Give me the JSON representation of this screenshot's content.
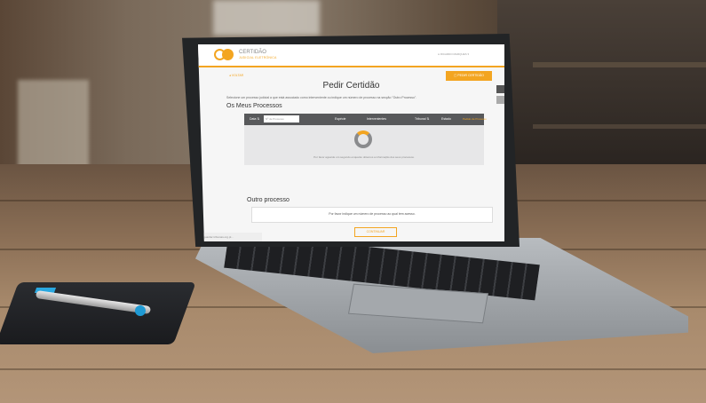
{
  "screen": {
    "brand": {
      "name": "CERTIDÃO",
      "tagline": "JUDICIAL ELETRÓNICA"
    },
    "header_right": "● RICARDO MARQUES ▾",
    "back_link": "◂ VOLTAR",
    "request_button": "▢  PEDIR CERTIDÃO",
    "page_title": "Pedir Certidão",
    "instruction": "Selecione um processo judicial a que está associado como interveniente ou indique um número de processo na secção \"Outro Processo\".",
    "my_processes": {
      "heading": "Os Meus Processos",
      "columns": [
        "Data ⇅",
        "Espécie",
        "Intervenientes",
        "Tribunal ⇅",
        "Estado",
        "Pedido de Processo"
      ],
      "search_placeholder": "Nº de Processo",
      "loading_text": "Por favor aguarde um segundo enquanto obtemos a informação dos seus processos."
    },
    "other_process": {
      "heading": "Outro processo",
      "hint": "Por favor indique um número de processo ao qual tem acesso.",
      "submit_label": "CONTINUAR"
    },
    "status_bar": "A aguardar tribunais.org.pt..."
  },
  "colors": {
    "accent": "#f3a521",
    "table_header": "#58595b",
    "table_body": "#e7e7e8"
  }
}
